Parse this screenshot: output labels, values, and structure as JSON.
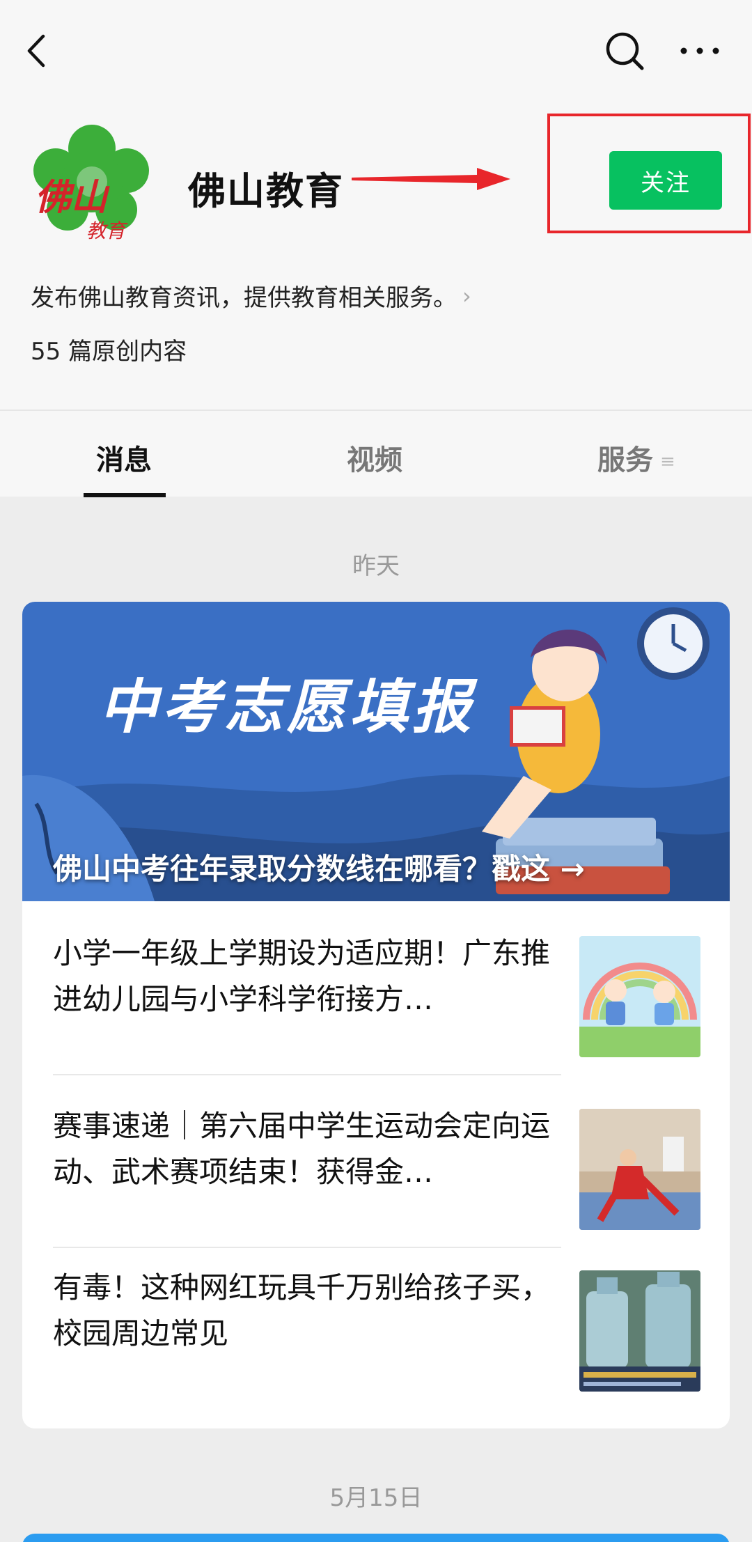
{
  "profile": {
    "name": "佛山教育",
    "logo_text": "佛山教育",
    "follow_label": "关注",
    "description": "发布佛山教育资讯，提供教育相关服务。",
    "original_count": "55 篇原创内容"
  },
  "tabs": [
    {
      "label": "消息",
      "active": true
    },
    {
      "label": "视频",
      "active": false
    },
    {
      "label": "服务",
      "active": false
    }
  ],
  "feed": {
    "date_1": "昨天",
    "banner": {
      "heading": "中考志愿填报",
      "caption": "佛山中考往年录取分数线在哪看？戳这 →"
    },
    "articles": [
      {
        "title": "小学一年级上学期设为适应期！广东推进幼儿园与小学科学衔接方…"
      },
      {
        "title": "赛事速递｜第六届中学生运动会定向运动、武术赛项结束！获得金…"
      },
      {
        "title": "有毒！这种网红玩具千万别给孩子买，校园周边常见"
      }
    ],
    "date_2": "5月15日"
  },
  "colors": {
    "follow_green": "#07c160",
    "annotation_red": "#e8262b",
    "banner_blue": "#3a6fc4"
  },
  "icons": [
    "back-icon",
    "search-icon",
    "more-icon"
  ]
}
